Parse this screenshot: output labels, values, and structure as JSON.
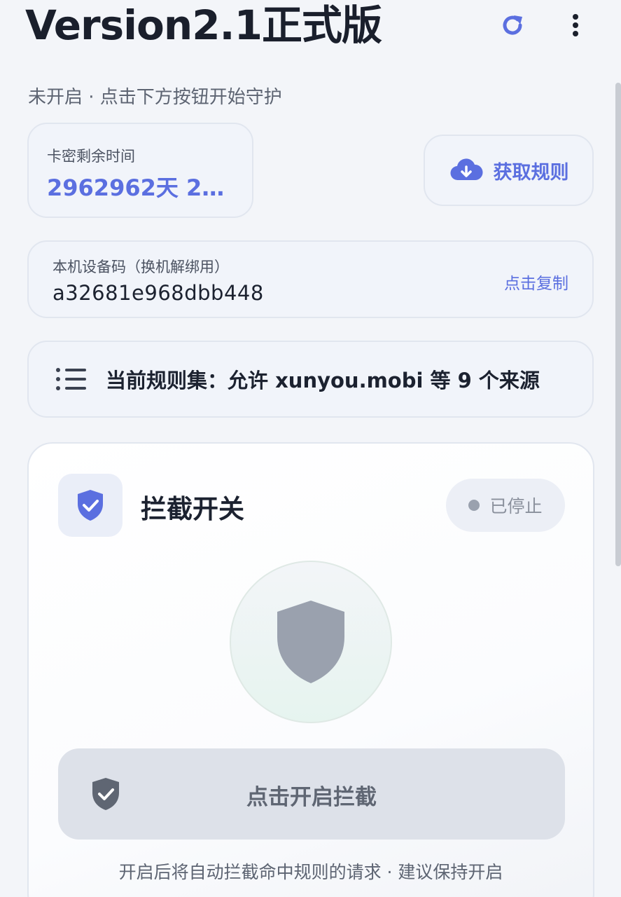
{
  "header": {
    "title": "Version2.1正式版",
    "status": "未开启 · 点击下方按钮开始守护"
  },
  "icons": {
    "refresh": "refresh-icon",
    "more": "more-vertical-icon",
    "cloud_download": "cloud-download-icon",
    "list": "list-icon",
    "shield_check": "shield-check-icon",
    "shield": "shield-icon"
  },
  "remaining": {
    "label": "卡密剩余时间",
    "value": "2962962天 23:…"
  },
  "fetch_rules": {
    "label": "获取规则"
  },
  "device": {
    "label": "本机设备码（换机解绑用）",
    "code": "a32681e968dbb448",
    "copy_label": "点击复制"
  },
  "ruleset": {
    "text": "当前规则集：允许 xunyou.mobi 等 9 个来源"
  },
  "panel": {
    "title": "拦截开关",
    "status": "已停止",
    "button_label": "点击开启拦截",
    "footer": "开启后将自动拦截命中规则的请求 · 建议保持开启"
  },
  "colors": {
    "accent": "#5b6fe0",
    "background": "#f3f5f9",
    "shield_inactive": "#9aa1ae"
  }
}
